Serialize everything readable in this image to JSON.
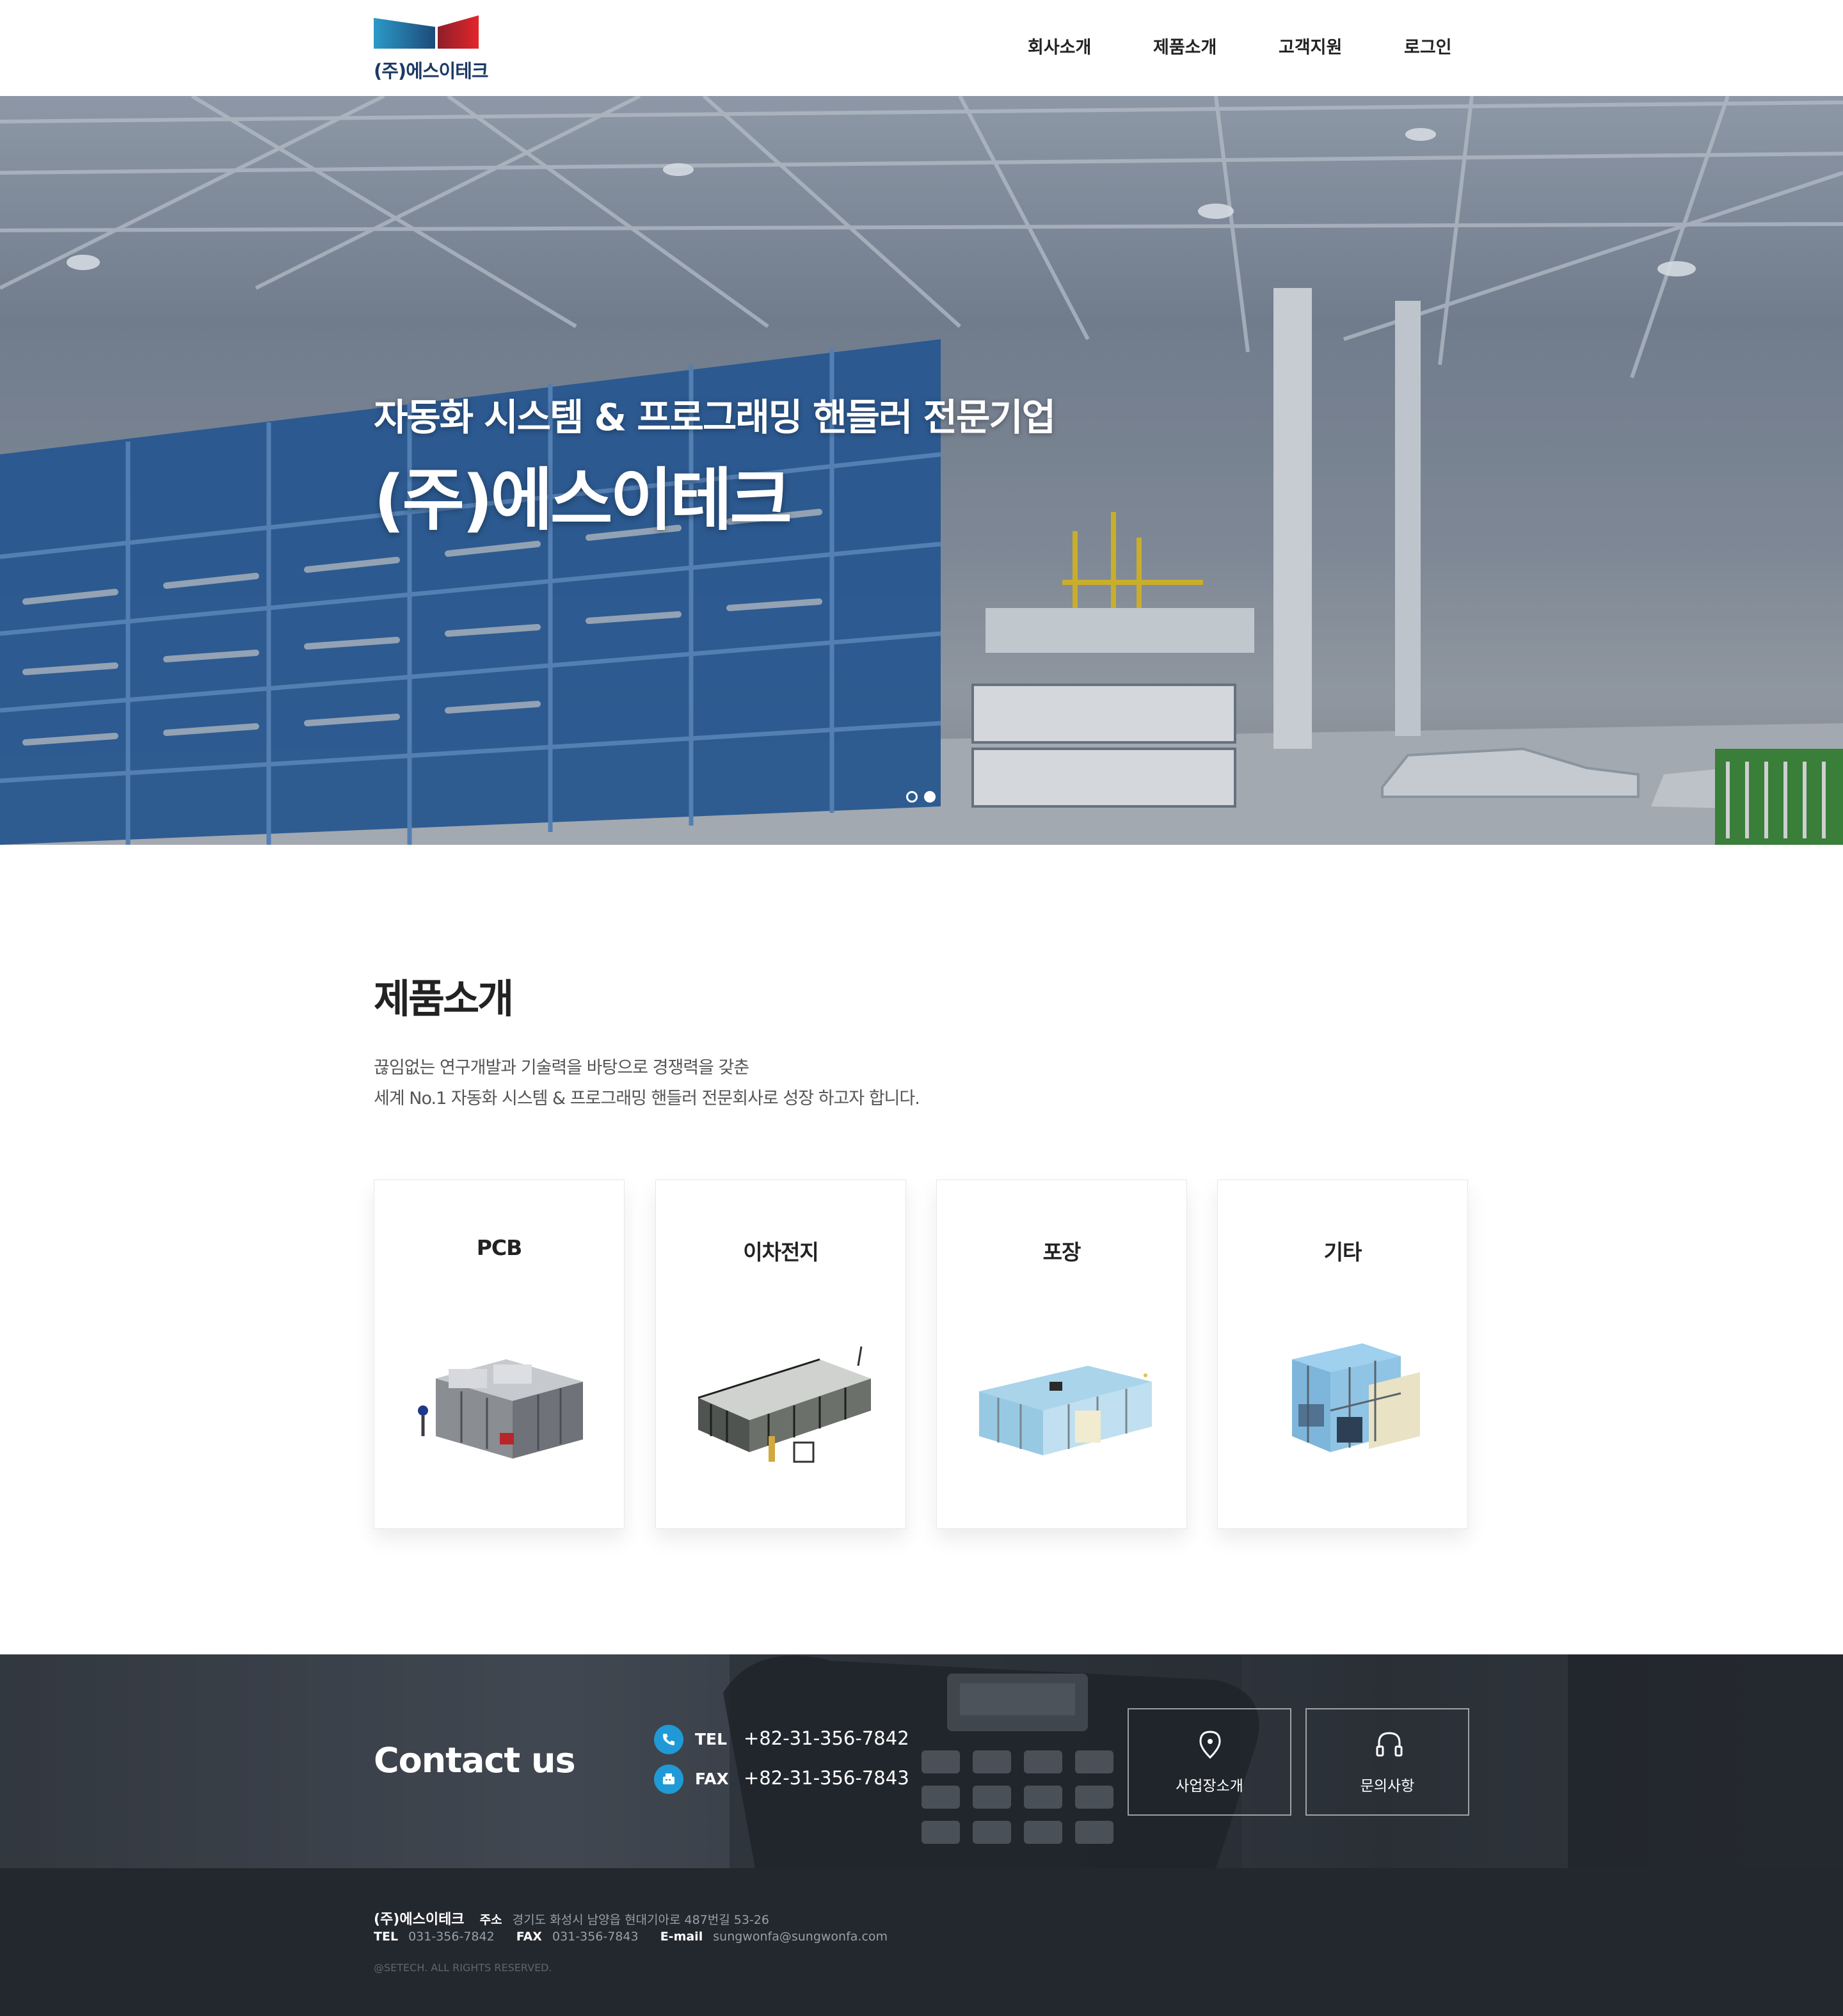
{
  "header": {
    "logo_text": "(주)에스이테크",
    "nav": [
      "회사소개",
      "제품소개",
      "고객지원",
      "로그인"
    ]
  },
  "hero": {
    "subtitle": "자동화 시스템 & 프로그래밍 핸들러 전문기업",
    "title": "(주)에스이테크",
    "slides_total": 2,
    "active_slide": 2
  },
  "products": {
    "title": "제품소개",
    "desc_line1": "끊임없는 연구개발과 기술력을 바탕으로 경쟁력을 갖춘",
    "desc_line2": "세계 No.1 자동화 시스템 & 프로그래밍 핸들러 전문회사로 성장 하고자 합니다.",
    "cards": [
      {
        "title": "PCB"
      },
      {
        "title": "이차전지"
      },
      {
        "title": "포장"
      },
      {
        "title": "기타"
      }
    ]
  },
  "contact": {
    "title": "Contact us",
    "tel_label": "TEL",
    "tel": "+82-31-356-7842",
    "fax_label": "FAX",
    "fax": "+82-31-356-7843",
    "buttons": [
      "사업장소개",
      "문의사항"
    ]
  },
  "footer": {
    "company": "(주)에스이테크",
    "address_label": "주소",
    "address": "경기도 화성시 남양읍 현대기아로 487번길 53-26",
    "tel_label": "TEL",
    "tel": "031-356-7842",
    "fax_label": "FAX",
    "fax": "031-356-7843",
    "email_label": "E-mail",
    "email": "sungwonfa@sungwonfa.com",
    "copyright": "@SETECH. ALL RIGHTS RESERVED."
  },
  "colors": {
    "logo_blue": "#2a7fb4",
    "logo_red": "#d6262b",
    "accent_icon": "#1f9ad6",
    "footer_bg": "#23272e"
  }
}
